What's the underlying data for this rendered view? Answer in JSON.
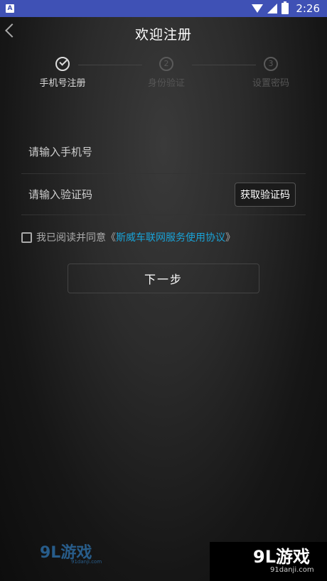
{
  "status": {
    "notif": "A",
    "time": "2:26"
  },
  "header": {
    "title": "欢迎注册"
  },
  "steps": [
    {
      "label": "手机号注册",
      "number": ""
    },
    {
      "label": "身份验证",
      "number": "2"
    },
    {
      "label": "设置密码",
      "number": "3"
    }
  ],
  "form": {
    "phone_placeholder": "请输入手机号",
    "code_placeholder": "请输入验证码",
    "get_code_label": "获取验证码"
  },
  "agreement": {
    "prefix": "我已阅读并同意",
    "open_bracket": "《",
    "link": "斯威车联网服务使用协议",
    "close_bracket": "》"
  },
  "next_label": "下一步",
  "watermark": {
    "left_main": "9L游戏",
    "left_sub": "91danji.com",
    "right_main": "9L游戏",
    "right_sub": "91danji.com"
  }
}
